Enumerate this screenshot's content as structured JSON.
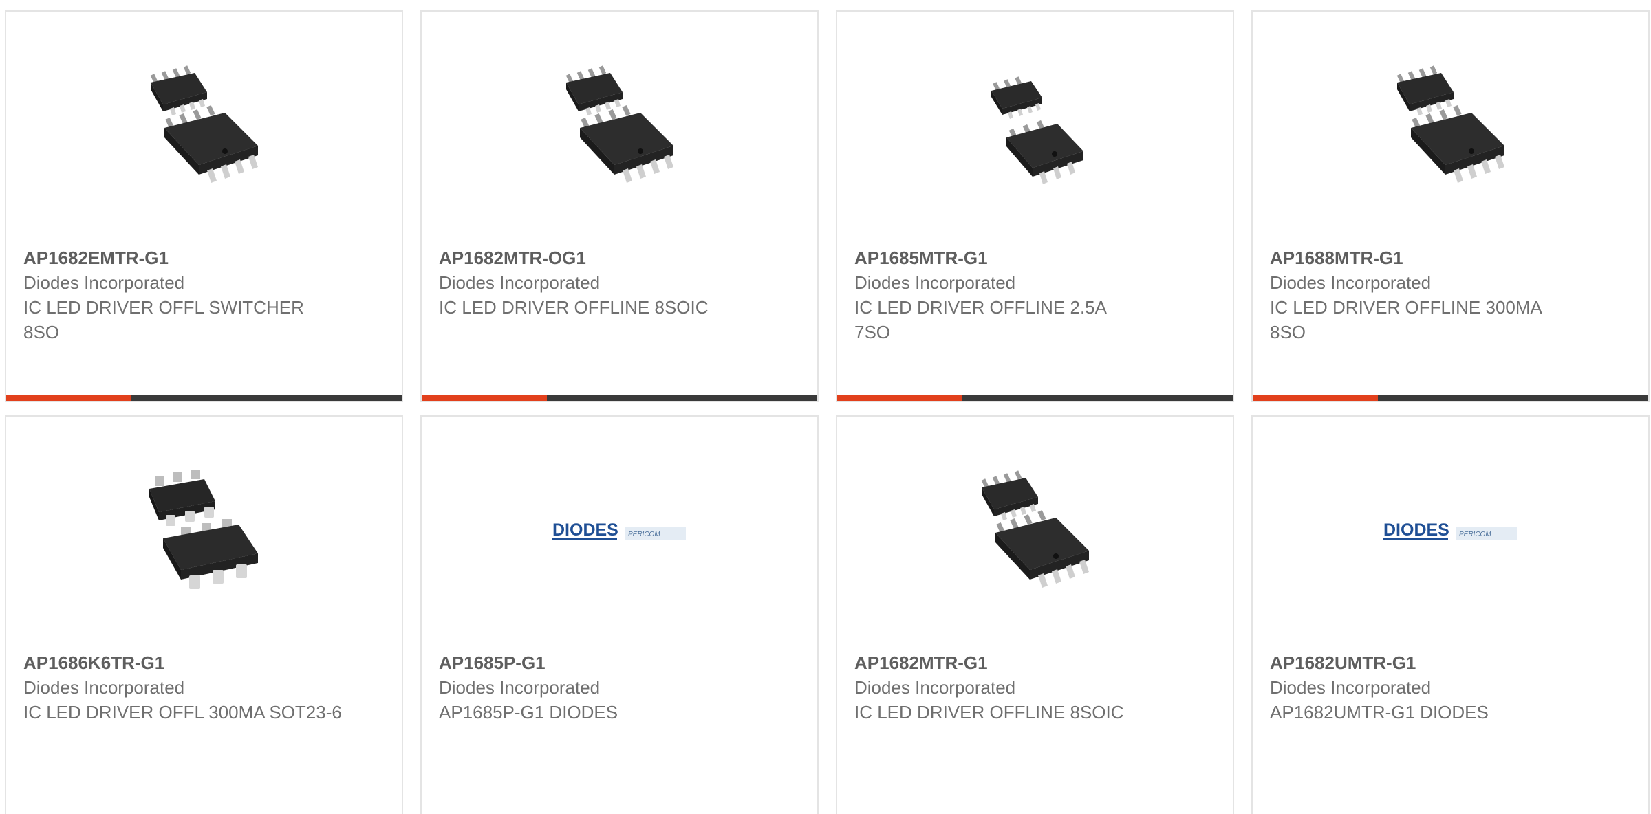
{
  "colors": {
    "accent": "#e2401c",
    "bar": "#3a3a3a",
    "border": "#e4e4e4",
    "title": "#5e5e5e",
    "text": "#6f6f6f"
  },
  "products": [
    {
      "part_number": "AP1682EMTR-G1",
      "manufacturer": "Diodes Incorporated",
      "description": "IC LED DRIVER OFFL SWITCHER 8SO",
      "image_icon": "soic-8-chip-icon"
    },
    {
      "part_number": "AP1682MTR-OG1",
      "manufacturer": "Diodes Incorporated",
      "description": "IC LED DRIVER OFFLINE 8SOIC",
      "image_icon": "soic-8-chip-icon"
    },
    {
      "part_number": "AP1685MTR-G1",
      "manufacturer": "Diodes Incorporated",
      "description": "IC LED DRIVER OFFLINE 2.5A 7SO",
      "image_icon": "so-7-chip-icon"
    },
    {
      "part_number": "AP1688MTR-G1",
      "manufacturer": "Diodes Incorporated",
      "description": "IC LED DRIVER OFFLINE 300MA 8SO",
      "image_icon": "soic-8-chip-icon"
    },
    {
      "part_number": "AP1686K6TR-G1",
      "manufacturer": "Diodes Incorporated",
      "description": "IC LED DRIVER OFFL 300MA SOT23-6",
      "image_icon": "sot23-6-chip-icon"
    },
    {
      "part_number": "AP1685P-G1",
      "manufacturer": "Diodes Incorporated",
      "description": "AP1685P-G1 DIODES",
      "image_icon": "diodes-pericom-logo",
      "logo_text": [
        "DIODES",
        "PERICOM"
      ]
    },
    {
      "part_number": "AP1682MTR-G1",
      "manufacturer": "Diodes Incorporated",
      "description": "IC LED DRIVER OFFLINE 8SOIC",
      "image_icon": "soic-8-chip-icon"
    },
    {
      "part_number": "AP1682UMTR-G1",
      "manufacturer": "Diodes Incorporated",
      "description": "AP1682UMTR-G1 DIODES",
      "image_icon": "diodes-pericom-logo",
      "logo_text": [
        "DIODES",
        "PERICOM"
      ]
    }
  ]
}
